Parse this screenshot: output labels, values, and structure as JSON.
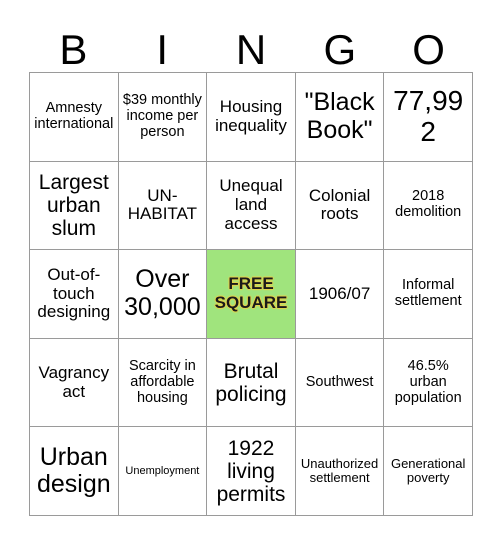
{
  "card": {
    "title": "BINGO",
    "header_letters": [
      "B",
      "I",
      "N",
      "G",
      "O"
    ],
    "free_square_color": "#a0e47d",
    "grid_line_color": "#9a9a9a",
    "text_color": "#000000",
    "rows": 5,
    "columns": 5
  },
  "cells": [
    {
      "text": "Amnesty international",
      "size": "fs-s",
      "free": false
    },
    {
      "text": "$39 monthly income per person",
      "size": "fs-s",
      "free": false
    },
    {
      "text": "Housing inequality",
      "size": "fs-m",
      "free": false
    },
    {
      "text": "\"Black Book\"",
      "size": "fs-xl",
      "free": false
    },
    {
      "text": "77,992",
      "size": "fs-xxl",
      "free": false
    },
    {
      "text": "Largest urban slum",
      "size": "fs-l",
      "free": false
    },
    {
      "text": "UN-HABITAT",
      "size": "fs-m",
      "free": false
    },
    {
      "text": "Unequal land access",
      "size": "fs-m",
      "free": false
    },
    {
      "text": "Colonial roots",
      "size": "fs-m",
      "free": false
    },
    {
      "text": "2018 demolition",
      "size": "fs-s",
      "free": false
    },
    {
      "text": "Out-of-touch designing",
      "size": "fs-m",
      "free": false
    },
    {
      "text": "Over 30,000",
      "size": "fs-xl",
      "free": false
    },
    {
      "text": "FREE SQUARE",
      "size": "fs-m",
      "free": true
    },
    {
      "text": "1906/07",
      "size": "fs-m",
      "free": false
    },
    {
      "text": "Informal settlement",
      "size": "fs-s",
      "free": false
    },
    {
      "text": "Vagrancy act",
      "size": "fs-m",
      "free": false
    },
    {
      "text": "Scarcity in affordable housing",
      "size": "fs-s",
      "free": false
    },
    {
      "text": "Brutal policing",
      "size": "fs-l",
      "free": false
    },
    {
      "text": "Southwest",
      "size": "fs-s",
      "free": false
    },
    {
      "text": "46.5% urban population",
      "size": "fs-s",
      "free": false
    },
    {
      "text": "Urban design",
      "size": "fs-xl",
      "free": false
    },
    {
      "text": "Unemployment",
      "size": "fs-xxs",
      "free": false
    },
    {
      "text": "1922 living permits",
      "size": "fs-l",
      "free": false
    },
    {
      "text": "Unauthorized settlement",
      "size": "fs-xs",
      "free": false
    },
    {
      "text": "Generational poverty",
      "size": "fs-xs",
      "free": false
    }
  ]
}
